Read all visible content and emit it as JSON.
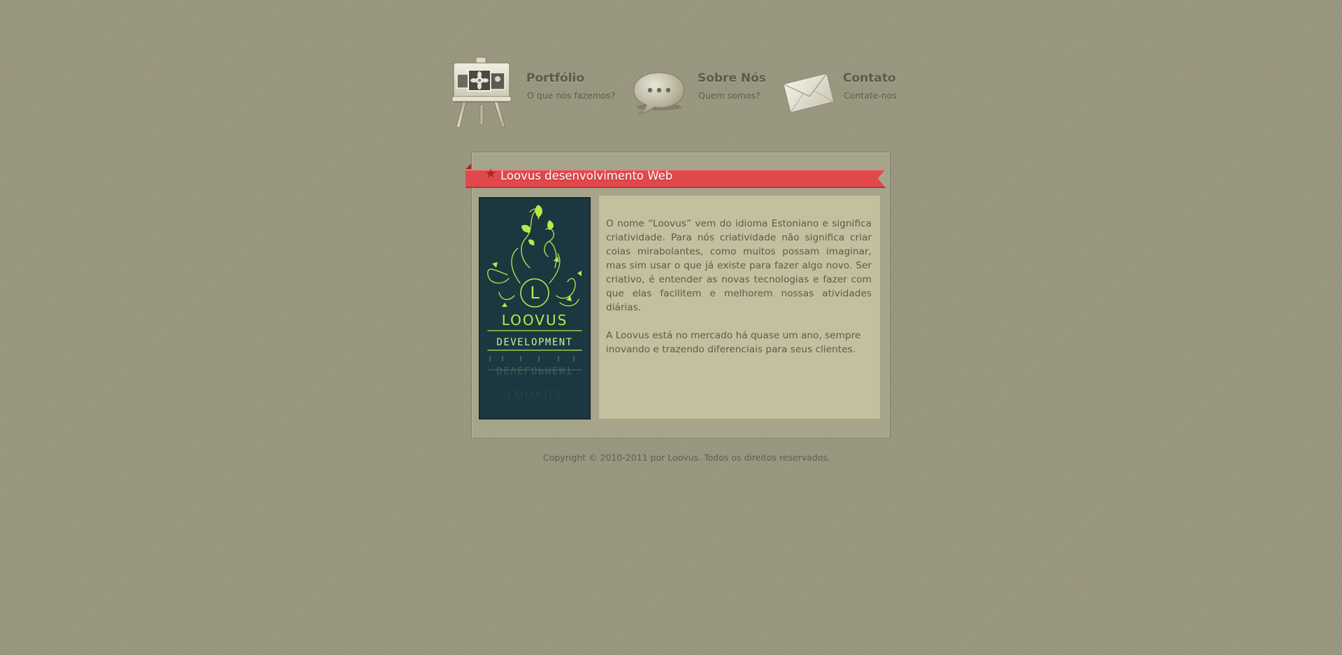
{
  "nav": {
    "items": [
      {
        "title": "Portfólio",
        "subtitle": "O que nós fazemos?",
        "icon": "easel-portfolio-icon"
      },
      {
        "title": "Sobre Nós",
        "subtitle": "Quem somos?",
        "icon": "speech-bubble-icon"
      },
      {
        "title": "Contato",
        "subtitle": "Contate-nos",
        "icon": "envelope-icon"
      }
    ]
  },
  "main": {
    "heading": "Loovus desenvolvimento Web",
    "heading_icon": "star-icon",
    "logo": {
      "name": "LOOVUS",
      "tagline": "DEVELOPMENT",
      "monogram": "L"
    },
    "paragraphs": [
      "O nome “Loovus” vem do idioma Estoniano e significa criatividade. Para nós criatividade não significa criar coias mirabolantes, como muitos possam imaginar, mas sim usar o que já existe para fazer algo novo. Ser criativo, é entender as novas tecnologias e fazer com que elas facilitem e melhorem nossas atividades diárias.",
      "A Loovus está no mercado há quase um ano, sempre inovando e trazendo diferenciais para seus clientes."
    ]
  },
  "footer": {
    "copyright": "Copyright © 2010-2011 por Loovus. Todos os direitos reservados."
  },
  "colors": {
    "background": "#9a9780",
    "ribbon": "#e0484c",
    "logo_background": "#1b3740",
    "logo_accent": "#b9e84a",
    "text_panel": "#c4c09f"
  }
}
